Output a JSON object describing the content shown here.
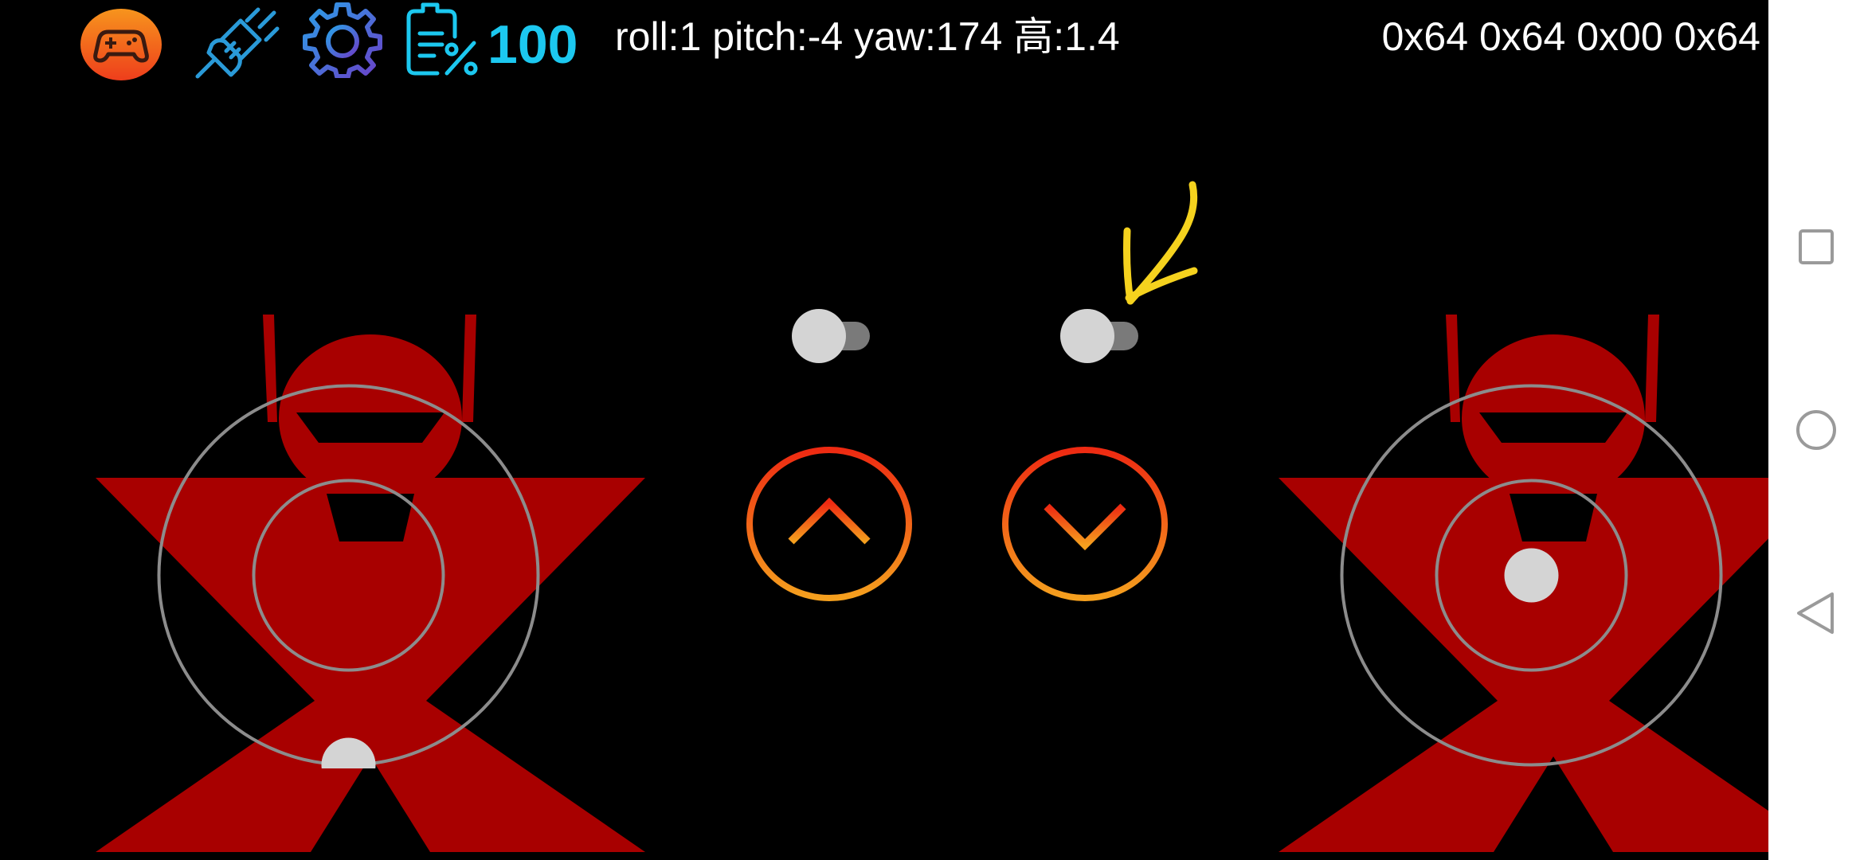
{
  "status_bar": {
    "battery_value": "100",
    "battery_color": "#1cc8f0",
    "telemetry": "roll:1  pitch:-4  yaw:174  高:1.4",
    "hex_readout": "0x64 0x64 0x00 0x64"
  },
  "icons": {
    "gamepad": "gamepad-icon",
    "connect": "plug-connect-icon",
    "settings": "gear-icon",
    "battery": "battery-percent-icon",
    "ascend": "chevron-up-icon",
    "descend": "chevron-down-icon",
    "annotation": "arrow-annotation-icon",
    "nav_recents": "square-icon",
    "nav_home": "circle-icon",
    "nav_back": "triangle-back-icon"
  },
  "controls": {
    "toggle_left_on": false,
    "toggle_right_on": false,
    "left_stick_knob": {
      "x": 0.0,
      "y": -1.0
    },
    "right_stick_knob": {
      "x": 0.0,
      "y": 0.0
    }
  },
  "colors": {
    "logo_red": "#a80000",
    "accent_orange": "#f07a1a",
    "accent_red": "#ee2a12",
    "annotation_yellow": "#f5d21e",
    "ring_gray": "#8c8c8c",
    "knob_gray": "#d4d4d4"
  }
}
